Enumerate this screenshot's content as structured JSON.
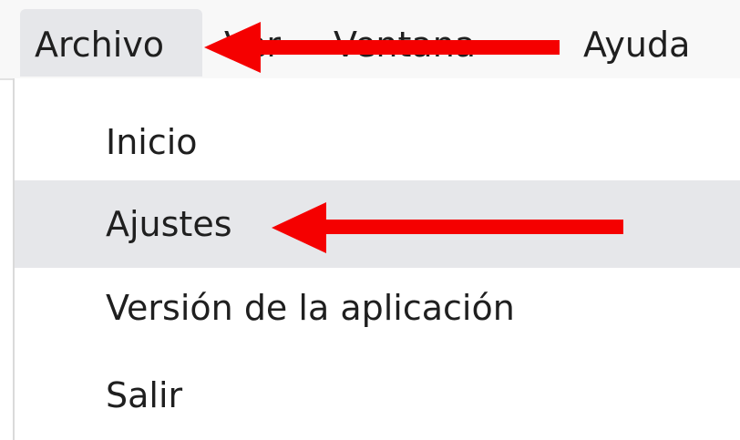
{
  "menubar": {
    "items": [
      {
        "label": "Archivo",
        "active": true
      },
      {
        "label": "Ver",
        "active": false
      },
      {
        "label": "Ventana",
        "active": false
      },
      {
        "label": "Ayuda",
        "active": false
      }
    ]
  },
  "dropdown": {
    "items": [
      {
        "label": "Inicio",
        "highlighted": false
      },
      {
        "label": "Ajustes",
        "highlighted": true
      },
      {
        "label": "Versión de la aplicación",
        "highlighted": false
      },
      {
        "label": "Salir",
        "highlighted": false
      }
    ]
  },
  "annotations": {
    "arrow_color": "#f50000",
    "arrows": [
      {
        "points_to": "Archivo",
        "icon": "left-arrow-icon"
      },
      {
        "points_to": "Ajustes",
        "icon": "left-arrow-icon"
      }
    ]
  },
  "colors": {
    "menubar_bg": "#f8f8f8",
    "active_item_bg": "#e6e7ea",
    "text": "#1f1f1f"
  }
}
